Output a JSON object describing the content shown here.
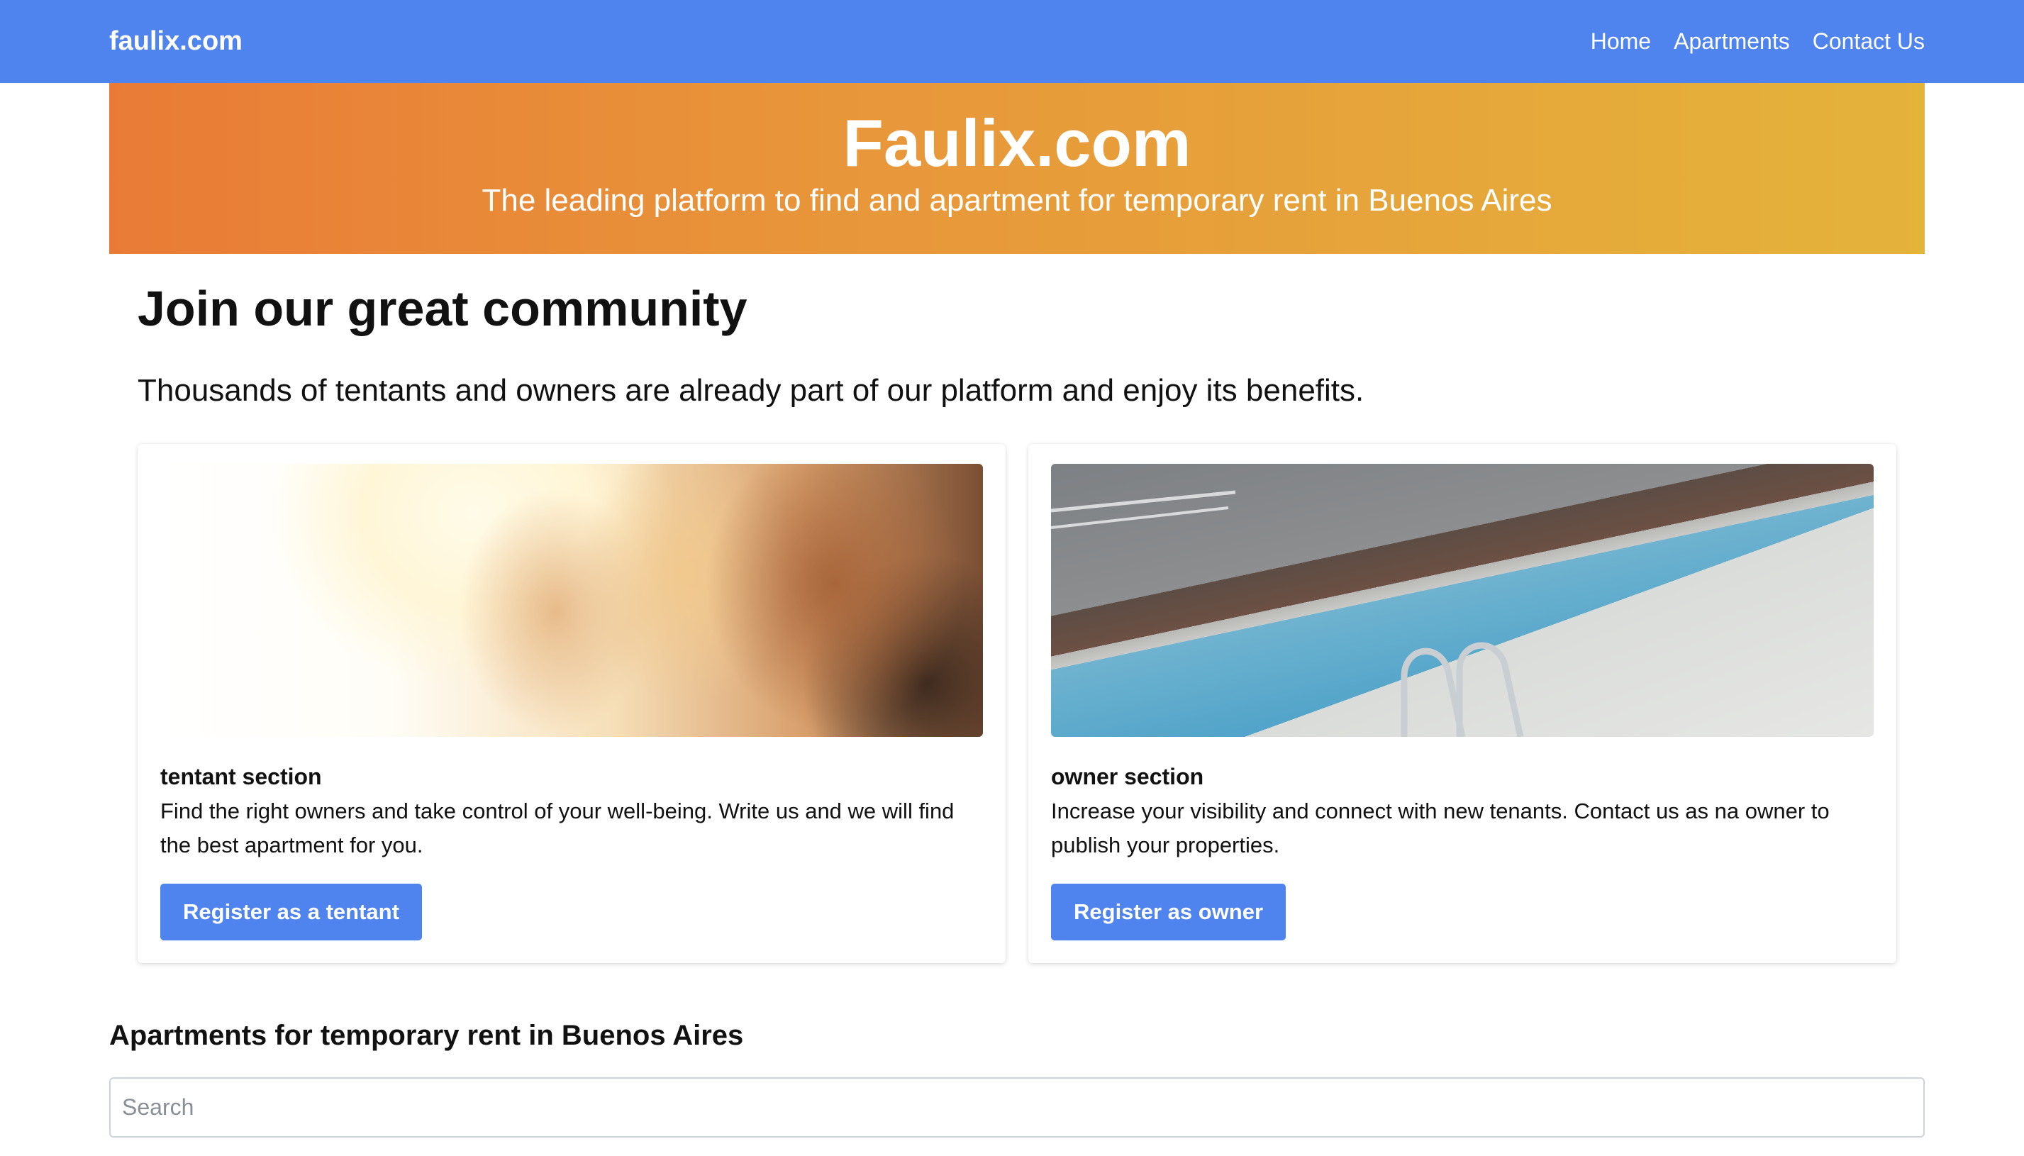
{
  "navbar": {
    "brand": "faulix.com",
    "links": [
      "Home",
      "Apartments",
      "Contact Us"
    ],
    "background_color": "#4f83ee"
  },
  "hero": {
    "title": "Faulix.com",
    "subtitle": "The leading platform to find and apartment for temporary rent in Buenos Aires",
    "gradient_start": "#e97b36",
    "gradient_end": "#e4b33a"
  },
  "community": {
    "title": "Join our great community",
    "text": "Thousands of tentants and owners are already part of our platform and enjoy its benefits."
  },
  "cards": [
    {
      "image": "two-laughing-women-photo",
      "title": "tentant section",
      "text": "Find the right owners and take control of your well-being. Write us and we will find the best apartment for you.",
      "button": "Register as a tentant"
    },
    {
      "image": "rooftop-swimming-pool-photo",
      "title": "owner section",
      "text": "Increase your visibility and connect with new tenants. Contact us as na owner to publish your properties.",
      "button": "Register as owner"
    }
  ],
  "apartments": {
    "title": "Apartments for temporary rent in Buenos Aires",
    "search_placeholder": "Search",
    "search_value": ""
  },
  "colors": {
    "accent": "#4f83ee",
    "text": "#111111"
  }
}
